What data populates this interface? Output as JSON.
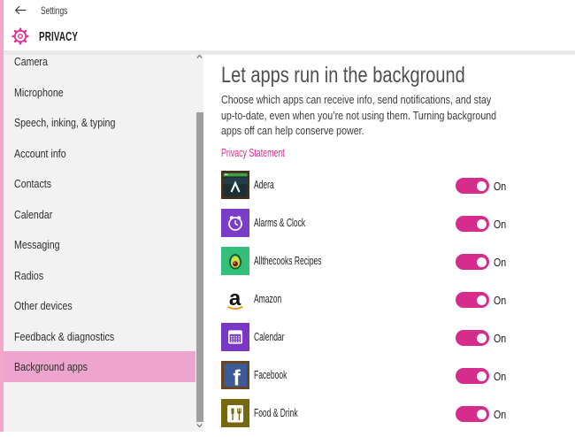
{
  "colors": {
    "accent": "#d62d8d",
    "selected_item_bg": "#eda4cd",
    "left_edge_stripe": "#f2a6ca"
  },
  "header": {
    "app_title": "Settings",
    "page_title": "PRIVACY"
  },
  "sidebar": {
    "items": [
      {
        "label": "Camera",
        "selected": false
      },
      {
        "label": "Microphone",
        "selected": false
      },
      {
        "label": "Speech, inking, & typing",
        "selected": false
      },
      {
        "label": "Account info",
        "selected": false
      },
      {
        "label": "Contacts",
        "selected": false
      },
      {
        "label": "Calendar",
        "selected": false
      },
      {
        "label": "Messaging",
        "selected": false
      },
      {
        "label": "Radios",
        "selected": false
      },
      {
        "label": "Other devices",
        "selected": false
      },
      {
        "label": "Feedback & diagnostics",
        "selected": false
      },
      {
        "label": "Background apps",
        "selected": true
      }
    ]
  },
  "main": {
    "title": "Let apps run in the background",
    "description_lines": [
      "Choose which apps can receive info, send notifications, and stay",
      "up-to-date, even when you’re not using them. Turning background",
      "apps off can help conserve power."
    ],
    "privacy_link": "Privacy Statement",
    "apps": [
      {
        "name": "Adera",
        "icon": "adera-app-icon",
        "state": "On"
      },
      {
        "name": "Alarms & Clock",
        "icon": "alarms-clock-app-icon",
        "state": "On"
      },
      {
        "name": "Allthecooks Recipes",
        "icon": "allthecooks-app-icon",
        "state": "On"
      },
      {
        "name": "Amazon",
        "icon": "amazon-app-icon",
        "state": "On"
      },
      {
        "name": "Calendar",
        "icon": "calendar-app-icon",
        "state": "On"
      },
      {
        "name": "Facebook",
        "icon": "facebook-app-icon",
        "state": "On"
      },
      {
        "name": "Food & Drink",
        "icon": "food-drink-app-icon",
        "state": "On"
      }
    ]
  }
}
